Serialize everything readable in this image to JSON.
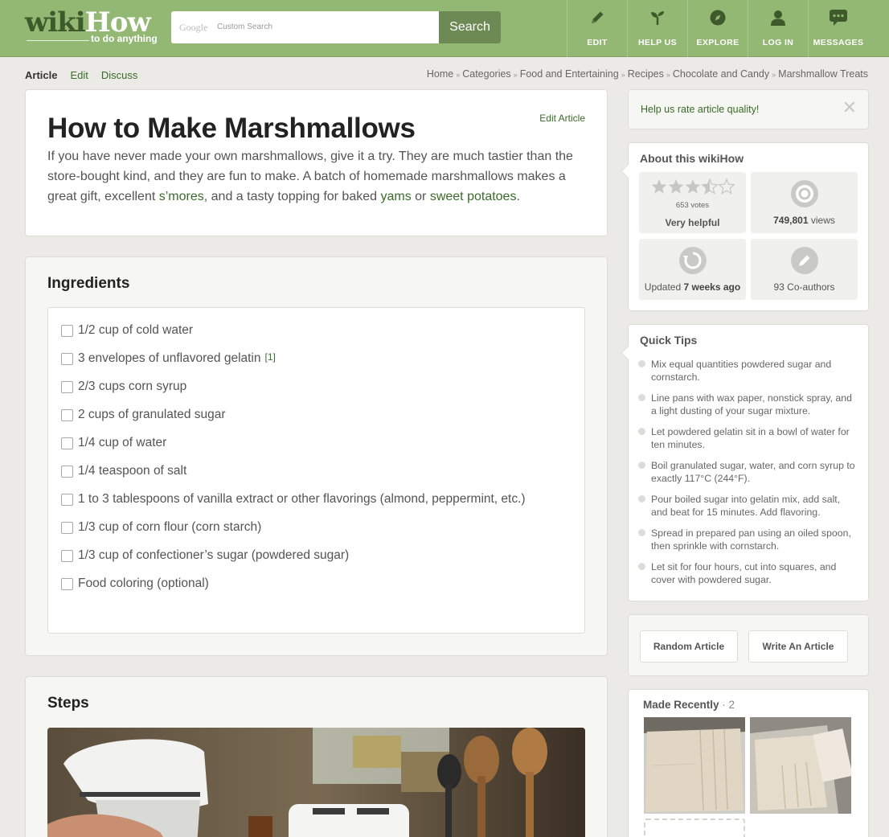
{
  "header": {
    "logo_wiki": "wiki",
    "logo_how": "How",
    "logo_tagline": "to do anything",
    "search_google_mark": "Google",
    "search_placeholder": "Custom Search",
    "search_button": "Search",
    "nav": [
      {
        "label": "EDIT",
        "icon": "pencil-icon"
      },
      {
        "label": "HELP US",
        "icon": "sprout-icon"
      },
      {
        "label": "EXPLORE",
        "icon": "compass-icon"
      },
      {
        "label": "LOG IN",
        "icon": "user-icon"
      },
      {
        "label": "MESSAGES",
        "icon": "chat-bubble-icon"
      }
    ]
  },
  "tabs": {
    "article": "Article",
    "edit": "Edit",
    "discuss": "Discuss"
  },
  "breadcrumb": [
    "Home",
    "Categories",
    "Food and Entertaining",
    "Recipes",
    "Chocolate and Candy",
    "Marshmallow Treats"
  ],
  "breadcrumb_separator": "»",
  "article": {
    "title": "How to Make Marshmallows",
    "edit_link": "Edit Article",
    "intro": {
      "p1": "If you have never made your own marshmallows, give it a try. They are much tastier than the store-bought kind, and they are fun to make. A batch of homemade marshmallows makes a great gift, excellent ",
      "link1": "s’mores",
      "p2": ", and a tasty topping for baked ",
      "link2": "yams",
      "p3": " or ",
      "link3": "sweet potatoes",
      "p4": "."
    },
    "ingredients_title": "Ingredients",
    "ingredients": [
      {
        "text": "1/2 cup of cold water"
      },
      {
        "text": "3 envelopes of unflavored gelatin",
        "ref": "[1]"
      },
      {
        "text": "2/3 cups corn syrup"
      },
      {
        "text": "2 cups of granulated sugar"
      },
      {
        "text": "1/4 cup of water"
      },
      {
        "text": "1/4 teaspoon of salt"
      },
      {
        "text": "1 to 3 tablespoons of vanilla extract or other flavorings (almond, peppermint, etc.)"
      },
      {
        "text": "1/3 cup of corn flour (corn starch)"
      },
      {
        "text": "1/3 cup of confectioner’s sugar (powdered sugar)"
      },
      {
        "text": "Food coloring (optional)"
      }
    ],
    "steps_title": "Steps"
  },
  "sidebar": {
    "rate_prompt": "Help us rate article quality!",
    "rate_close": "✕",
    "about_title": "About this wikiHow",
    "rating": {
      "stars": 3.5,
      "max_stars": 5,
      "votes_label": "653 votes",
      "label": "Very helpful"
    },
    "views": {
      "number": "749,801",
      "suffix": " views"
    },
    "updated": {
      "prefix": "Updated ",
      "value": "7 weeks ago"
    },
    "coauthors": "93 Co-authors",
    "tips_title": "Quick Tips",
    "tips": [
      "Mix equal quantities powdered sugar and cornstarch.",
      "Line pans with wax paper, nonstick spray, and a light dusting of your sugar mixture.",
      "Let powdered gelatin sit in a bowl of water for ten minutes.",
      "Boil granulated sugar, water, and corn syrup to exactly 117°C (244°F).",
      "Pour boiled sugar into gelatin mix, add salt, and beat for 15 minutes. Add flavoring.",
      "Spread in prepared pan using an oiled spoon, then sprinkle with cornstarch.",
      "Let sit for four hours, cut into squares, and cover with powdered sugar."
    ],
    "random_article": "Random Article",
    "write_article": "Write An Article",
    "made_recently_title": "Made Recently",
    "made_recently_count": " · 2"
  },
  "colors": {
    "header_green": "#93b874",
    "link_green": "#3a6b2a",
    "search_button": "#6d8a55",
    "page_bg": "#ebeae6"
  }
}
